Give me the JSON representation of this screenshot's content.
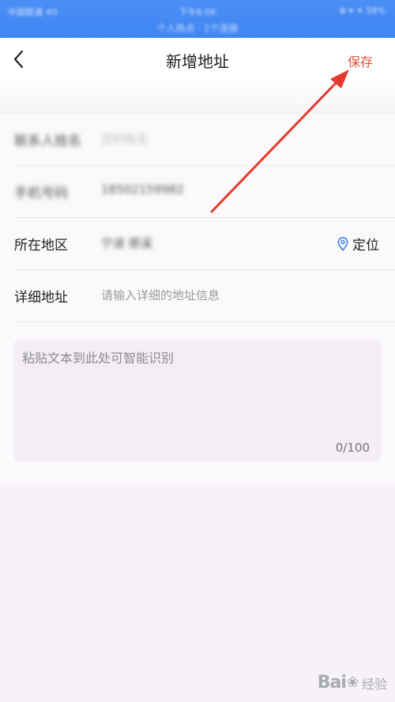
{
  "status_bar": {
    "carrier": "中国联通 4G",
    "time": "下午6:06",
    "indicators": "⊕ ▾ ✦ 58%",
    "subtitle": "个人热点 · 1个连接"
  },
  "nav": {
    "back_icon": "chevron-left-icon",
    "title": "新增地址",
    "save_label": "保存"
  },
  "form": {
    "contact_name": {
      "label": "联系人姓名",
      "value": "您的姓名"
    },
    "phone": {
      "label": "手机号码",
      "value": "18502159982"
    },
    "region": {
      "label": "所在地区",
      "value": "宁波 慈溪",
      "locate_label": "定位",
      "locate_icon": "location-pin-icon"
    },
    "detail": {
      "label": "详细地址",
      "placeholder": "请输入详细的地址信息"
    },
    "paste": {
      "placeholder": "粘贴文本到此处可智能识别",
      "count": "0/100"
    }
  },
  "colors": {
    "status_bar": "#3f86f2",
    "save": "#e0523f",
    "arrow": "#e53b2c",
    "locate_icon": "#3d7fe8"
  },
  "watermark": {
    "logo": "Bai",
    "text": "经验"
  }
}
